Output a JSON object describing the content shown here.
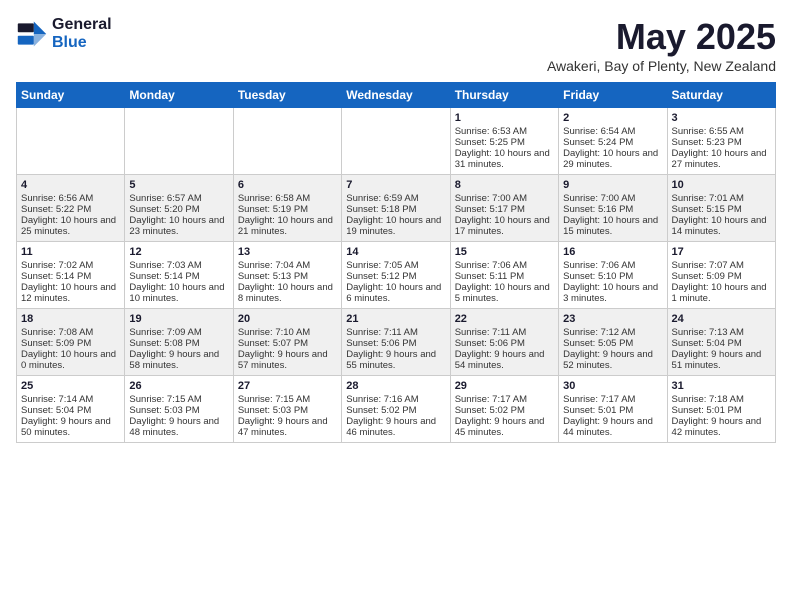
{
  "header": {
    "logo_general": "General",
    "logo_blue": "Blue",
    "title": "May 2025",
    "subtitle": "Awakeri, Bay of Plenty, New Zealand"
  },
  "weekdays": [
    "Sunday",
    "Monday",
    "Tuesday",
    "Wednesday",
    "Thursday",
    "Friday",
    "Saturday"
  ],
  "weeks": [
    [
      {
        "day": "",
        "info": ""
      },
      {
        "day": "",
        "info": ""
      },
      {
        "day": "",
        "info": ""
      },
      {
        "day": "",
        "info": ""
      },
      {
        "day": "1",
        "info": "Sunrise: 6:53 AM\nSunset: 5:25 PM\nDaylight: 10 hours and 31 minutes."
      },
      {
        "day": "2",
        "info": "Sunrise: 6:54 AM\nSunset: 5:24 PM\nDaylight: 10 hours and 29 minutes."
      },
      {
        "day": "3",
        "info": "Sunrise: 6:55 AM\nSunset: 5:23 PM\nDaylight: 10 hours and 27 minutes."
      }
    ],
    [
      {
        "day": "4",
        "info": "Sunrise: 6:56 AM\nSunset: 5:22 PM\nDaylight: 10 hours and 25 minutes."
      },
      {
        "day": "5",
        "info": "Sunrise: 6:57 AM\nSunset: 5:20 PM\nDaylight: 10 hours and 23 minutes."
      },
      {
        "day": "6",
        "info": "Sunrise: 6:58 AM\nSunset: 5:19 PM\nDaylight: 10 hours and 21 minutes."
      },
      {
        "day": "7",
        "info": "Sunrise: 6:59 AM\nSunset: 5:18 PM\nDaylight: 10 hours and 19 minutes."
      },
      {
        "day": "8",
        "info": "Sunrise: 7:00 AM\nSunset: 5:17 PM\nDaylight: 10 hours and 17 minutes."
      },
      {
        "day": "9",
        "info": "Sunrise: 7:00 AM\nSunset: 5:16 PM\nDaylight: 10 hours and 15 minutes."
      },
      {
        "day": "10",
        "info": "Sunrise: 7:01 AM\nSunset: 5:15 PM\nDaylight: 10 hours and 14 minutes."
      }
    ],
    [
      {
        "day": "11",
        "info": "Sunrise: 7:02 AM\nSunset: 5:14 PM\nDaylight: 10 hours and 12 minutes."
      },
      {
        "day": "12",
        "info": "Sunrise: 7:03 AM\nSunset: 5:14 PM\nDaylight: 10 hours and 10 minutes."
      },
      {
        "day": "13",
        "info": "Sunrise: 7:04 AM\nSunset: 5:13 PM\nDaylight: 10 hours and 8 minutes."
      },
      {
        "day": "14",
        "info": "Sunrise: 7:05 AM\nSunset: 5:12 PM\nDaylight: 10 hours and 6 minutes."
      },
      {
        "day": "15",
        "info": "Sunrise: 7:06 AM\nSunset: 5:11 PM\nDaylight: 10 hours and 5 minutes."
      },
      {
        "day": "16",
        "info": "Sunrise: 7:06 AM\nSunset: 5:10 PM\nDaylight: 10 hours and 3 minutes."
      },
      {
        "day": "17",
        "info": "Sunrise: 7:07 AM\nSunset: 5:09 PM\nDaylight: 10 hours and 1 minute."
      }
    ],
    [
      {
        "day": "18",
        "info": "Sunrise: 7:08 AM\nSunset: 5:09 PM\nDaylight: 10 hours and 0 minutes."
      },
      {
        "day": "19",
        "info": "Sunrise: 7:09 AM\nSunset: 5:08 PM\nDaylight: 9 hours and 58 minutes."
      },
      {
        "day": "20",
        "info": "Sunrise: 7:10 AM\nSunset: 5:07 PM\nDaylight: 9 hours and 57 minutes."
      },
      {
        "day": "21",
        "info": "Sunrise: 7:11 AM\nSunset: 5:06 PM\nDaylight: 9 hours and 55 minutes."
      },
      {
        "day": "22",
        "info": "Sunrise: 7:11 AM\nSunset: 5:06 PM\nDaylight: 9 hours and 54 minutes."
      },
      {
        "day": "23",
        "info": "Sunrise: 7:12 AM\nSunset: 5:05 PM\nDaylight: 9 hours and 52 minutes."
      },
      {
        "day": "24",
        "info": "Sunrise: 7:13 AM\nSunset: 5:04 PM\nDaylight: 9 hours and 51 minutes."
      }
    ],
    [
      {
        "day": "25",
        "info": "Sunrise: 7:14 AM\nSunset: 5:04 PM\nDaylight: 9 hours and 50 minutes."
      },
      {
        "day": "26",
        "info": "Sunrise: 7:15 AM\nSunset: 5:03 PM\nDaylight: 9 hours and 48 minutes."
      },
      {
        "day": "27",
        "info": "Sunrise: 7:15 AM\nSunset: 5:03 PM\nDaylight: 9 hours and 47 minutes."
      },
      {
        "day": "28",
        "info": "Sunrise: 7:16 AM\nSunset: 5:02 PM\nDaylight: 9 hours and 46 minutes."
      },
      {
        "day": "29",
        "info": "Sunrise: 7:17 AM\nSunset: 5:02 PM\nDaylight: 9 hours and 45 minutes."
      },
      {
        "day": "30",
        "info": "Sunrise: 7:17 AM\nSunset: 5:01 PM\nDaylight: 9 hours and 44 minutes."
      },
      {
        "day": "31",
        "info": "Sunrise: 7:18 AM\nSunset: 5:01 PM\nDaylight: 9 hours and 42 minutes."
      }
    ]
  ]
}
